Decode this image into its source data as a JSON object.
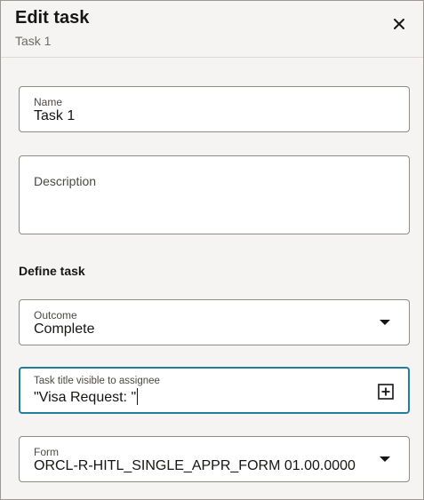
{
  "dialog": {
    "title": "Edit task",
    "subtitle": "Task 1"
  },
  "fields": {
    "name": {
      "label": "Name",
      "value": "Task 1"
    },
    "description": {
      "label": "Description",
      "value": ""
    },
    "outcome": {
      "label": "Outcome",
      "value": "Complete"
    },
    "task_title": {
      "label": "Task title visible to assignee",
      "value": "\"Visa Request: \""
    },
    "form": {
      "label": "Form",
      "value": "ORCL-R-HITL_SINGLE_APPR_FORM 01.00.0000"
    }
  },
  "section": {
    "define_task": "Define task"
  },
  "icons": {
    "close": "close-icon",
    "dropdown": "chevron-down-icon",
    "insert": "add-expression-icon"
  },
  "colors": {
    "focus_border": "#227e9e",
    "panel_background": "#f5f4f2"
  }
}
